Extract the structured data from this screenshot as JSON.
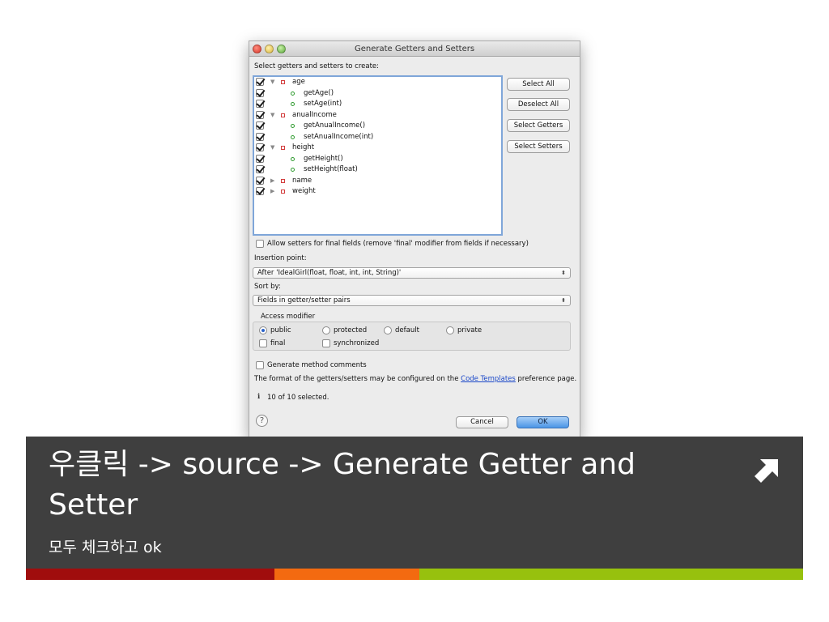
{
  "dialog": {
    "title": "Generate Getters and Setters",
    "prompt": "Select getters and setters to create:",
    "tree": [
      {
        "kind": "field",
        "label": "age",
        "expanded": true
      },
      {
        "kind": "method",
        "label": "getAge()"
      },
      {
        "kind": "method",
        "label": "setAge(int)"
      },
      {
        "kind": "field",
        "label": "anualIncome",
        "expanded": true
      },
      {
        "kind": "method",
        "label": "getAnualIncome()"
      },
      {
        "kind": "method",
        "label": "setAnualIncome(int)"
      },
      {
        "kind": "field",
        "label": "height",
        "expanded": true
      },
      {
        "kind": "method",
        "label": "getHeight()"
      },
      {
        "kind": "method",
        "label": "setHeight(float)"
      },
      {
        "kind": "field",
        "label": "name",
        "expanded": false
      },
      {
        "kind": "field",
        "label": "weight",
        "expanded": false
      }
    ],
    "buttons": {
      "select_all": "Select All",
      "deselect_all": "Deselect All",
      "select_getters": "Select Getters",
      "select_setters": "Select Setters"
    },
    "allow_final": "Allow setters for final fields (remove 'final' modifier from fields if necessary)",
    "insertion_label": "Insertion point:",
    "insertion_value": "After 'IdealGirl(float, float, int, int, String)'",
    "sort_label": "Sort by:",
    "sort_value": "Fields in getter/setter pairs",
    "access": {
      "title": "Access modifier",
      "public": "public",
      "protected": "protected",
      "default": "default",
      "private": "private",
      "final": "final",
      "synchronized": "synchronized"
    },
    "generate_comments": "Generate method comments",
    "format_prefix": "The format of the getters/setters may be configured on the",
    "format_link": "Code Templates",
    "format_suffix": "preference page.",
    "info_icon_text": "i",
    "status": "10 of 10 selected.",
    "help_symbol": "?",
    "cancel": "Cancel",
    "ok": "OK"
  },
  "caption": {
    "headline": "우클릭 -> source -> Generate Getter and Setter",
    "sub": "모두 체크하고 ok"
  },
  "colors": {
    "banner": "#3f3f3f",
    "stripe_red": "#a00d0d",
    "stripe_orange": "#f36a10",
    "stripe_green": "#97c10e"
  }
}
